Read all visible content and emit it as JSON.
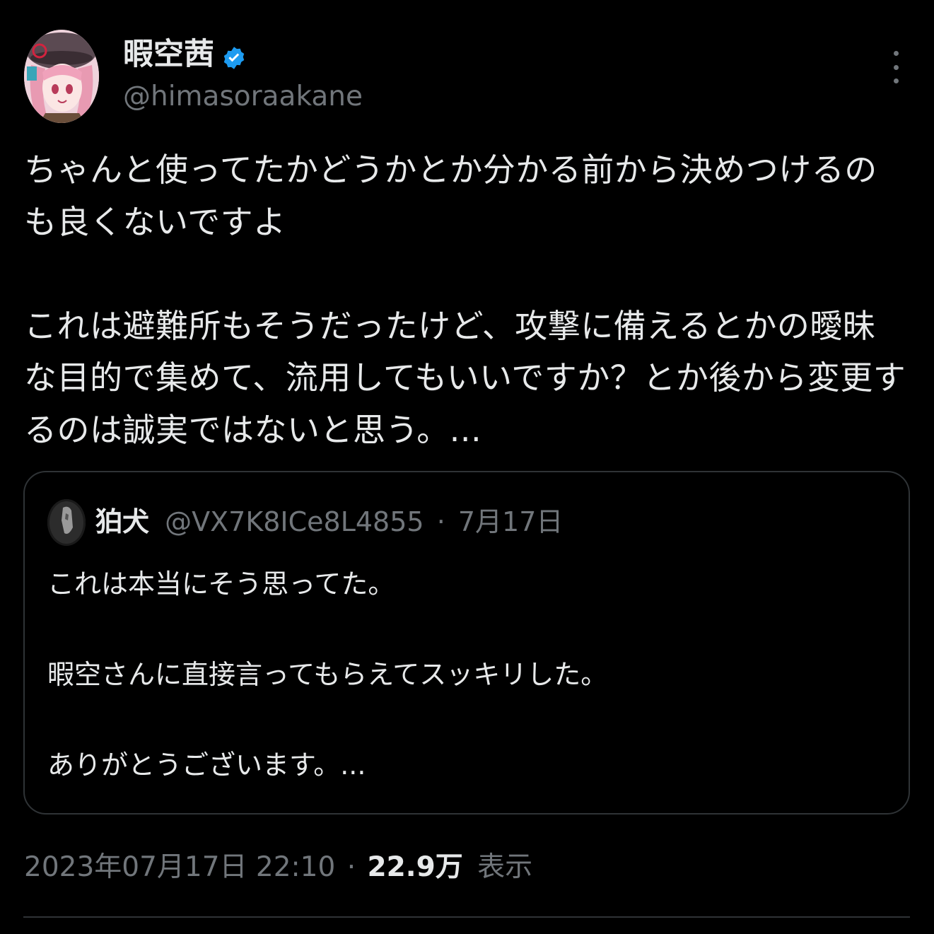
{
  "author": {
    "display_name": "暇空茜",
    "handle": "@himasoraakane",
    "verified_icon": "verified-badge-icon",
    "avatar_icon": "anime-avatar"
  },
  "tweet": {
    "text": "ちゃんと使ってたかどうかとか分かる前から決めつけるのも良くないですよ\n\nこれは避難所もそうだったけど、攻撃に備えるとかの曖昧な目的で集めて、流用してもいいですか？とか後から変更するのは誠実ではないと思う。..."
  },
  "quote": {
    "display_name": "狛犬",
    "handle": "@VX7K8ICe8L4855",
    "separator": "·",
    "date": "7月17日",
    "text": "これは本当にそう思ってた。\n\n暇空さんに直接言ってもらえてスッキリした。\n\nありがとうございます。..."
  },
  "meta": {
    "timestamp": "2023年07月17日 22:10",
    "separator": "·",
    "views_count": "22.9万",
    "views_label": "表示"
  },
  "colors": {
    "background": "#000000",
    "text_primary": "#e7e9ea",
    "text_secondary": "#71767b",
    "border": "#2f3336",
    "verified": "#1d9bf0"
  }
}
